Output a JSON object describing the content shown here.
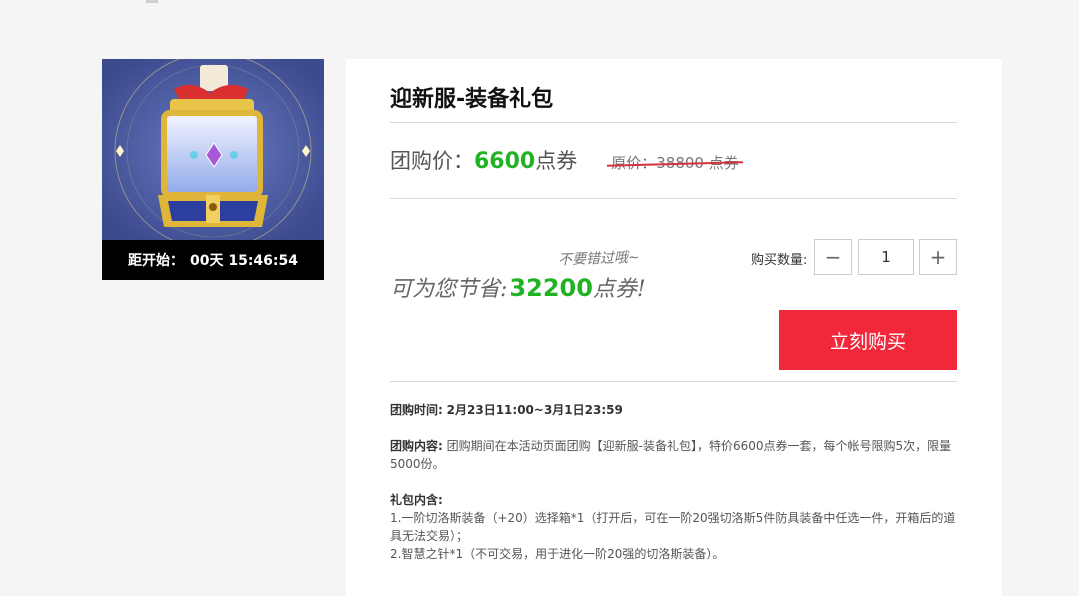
{
  "countdown": {
    "label": "距开始：",
    "value": "00天 15:46:54"
  },
  "product": {
    "title": "迎新服-装备礼包"
  },
  "price": {
    "label": "团购价：",
    "value": "6600",
    "unit": "点券",
    "original": "原价：38800 点券"
  },
  "savings": {
    "tagline": "不要错过哦~",
    "label": "可为您节省:",
    "value": "32200",
    "unit": "点券!"
  },
  "quantity": {
    "label": "购买数量:",
    "minus": "−",
    "value": "1",
    "plus": "+"
  },
  "buy_button": "立刻购买",
  "details": {
    "time_label": "团购时间:",
    "time_value": "2月23日11:00~3月1日23:59",
    "content_label": "团购内容:",
    "content_value": "团购期间在本活动页面团购【迎新服-装备礼包】，特价6600点券一套，每个帐号限购5次，限量5000份。",
    "includes_label": "礼包内含:",
    "item1": "1.一阶切洛斯装备（+20）选择箱*1（打开后，可在一阶20强切洛斯5件防具装备中任选一件，开箱后的道具无法交易）；",
    "item2": "2.智慧之针*1（不可交易，用于进化一阶20强的切洛斯装备）。"
  },
  "colors": {
    "accent_green": "#22b324",
    "buy_red": "#f0283a",
    "countdown_bg": "#000000"
  },
  "icons": {
    "product": "treasure-chest-icon"
  }
}
